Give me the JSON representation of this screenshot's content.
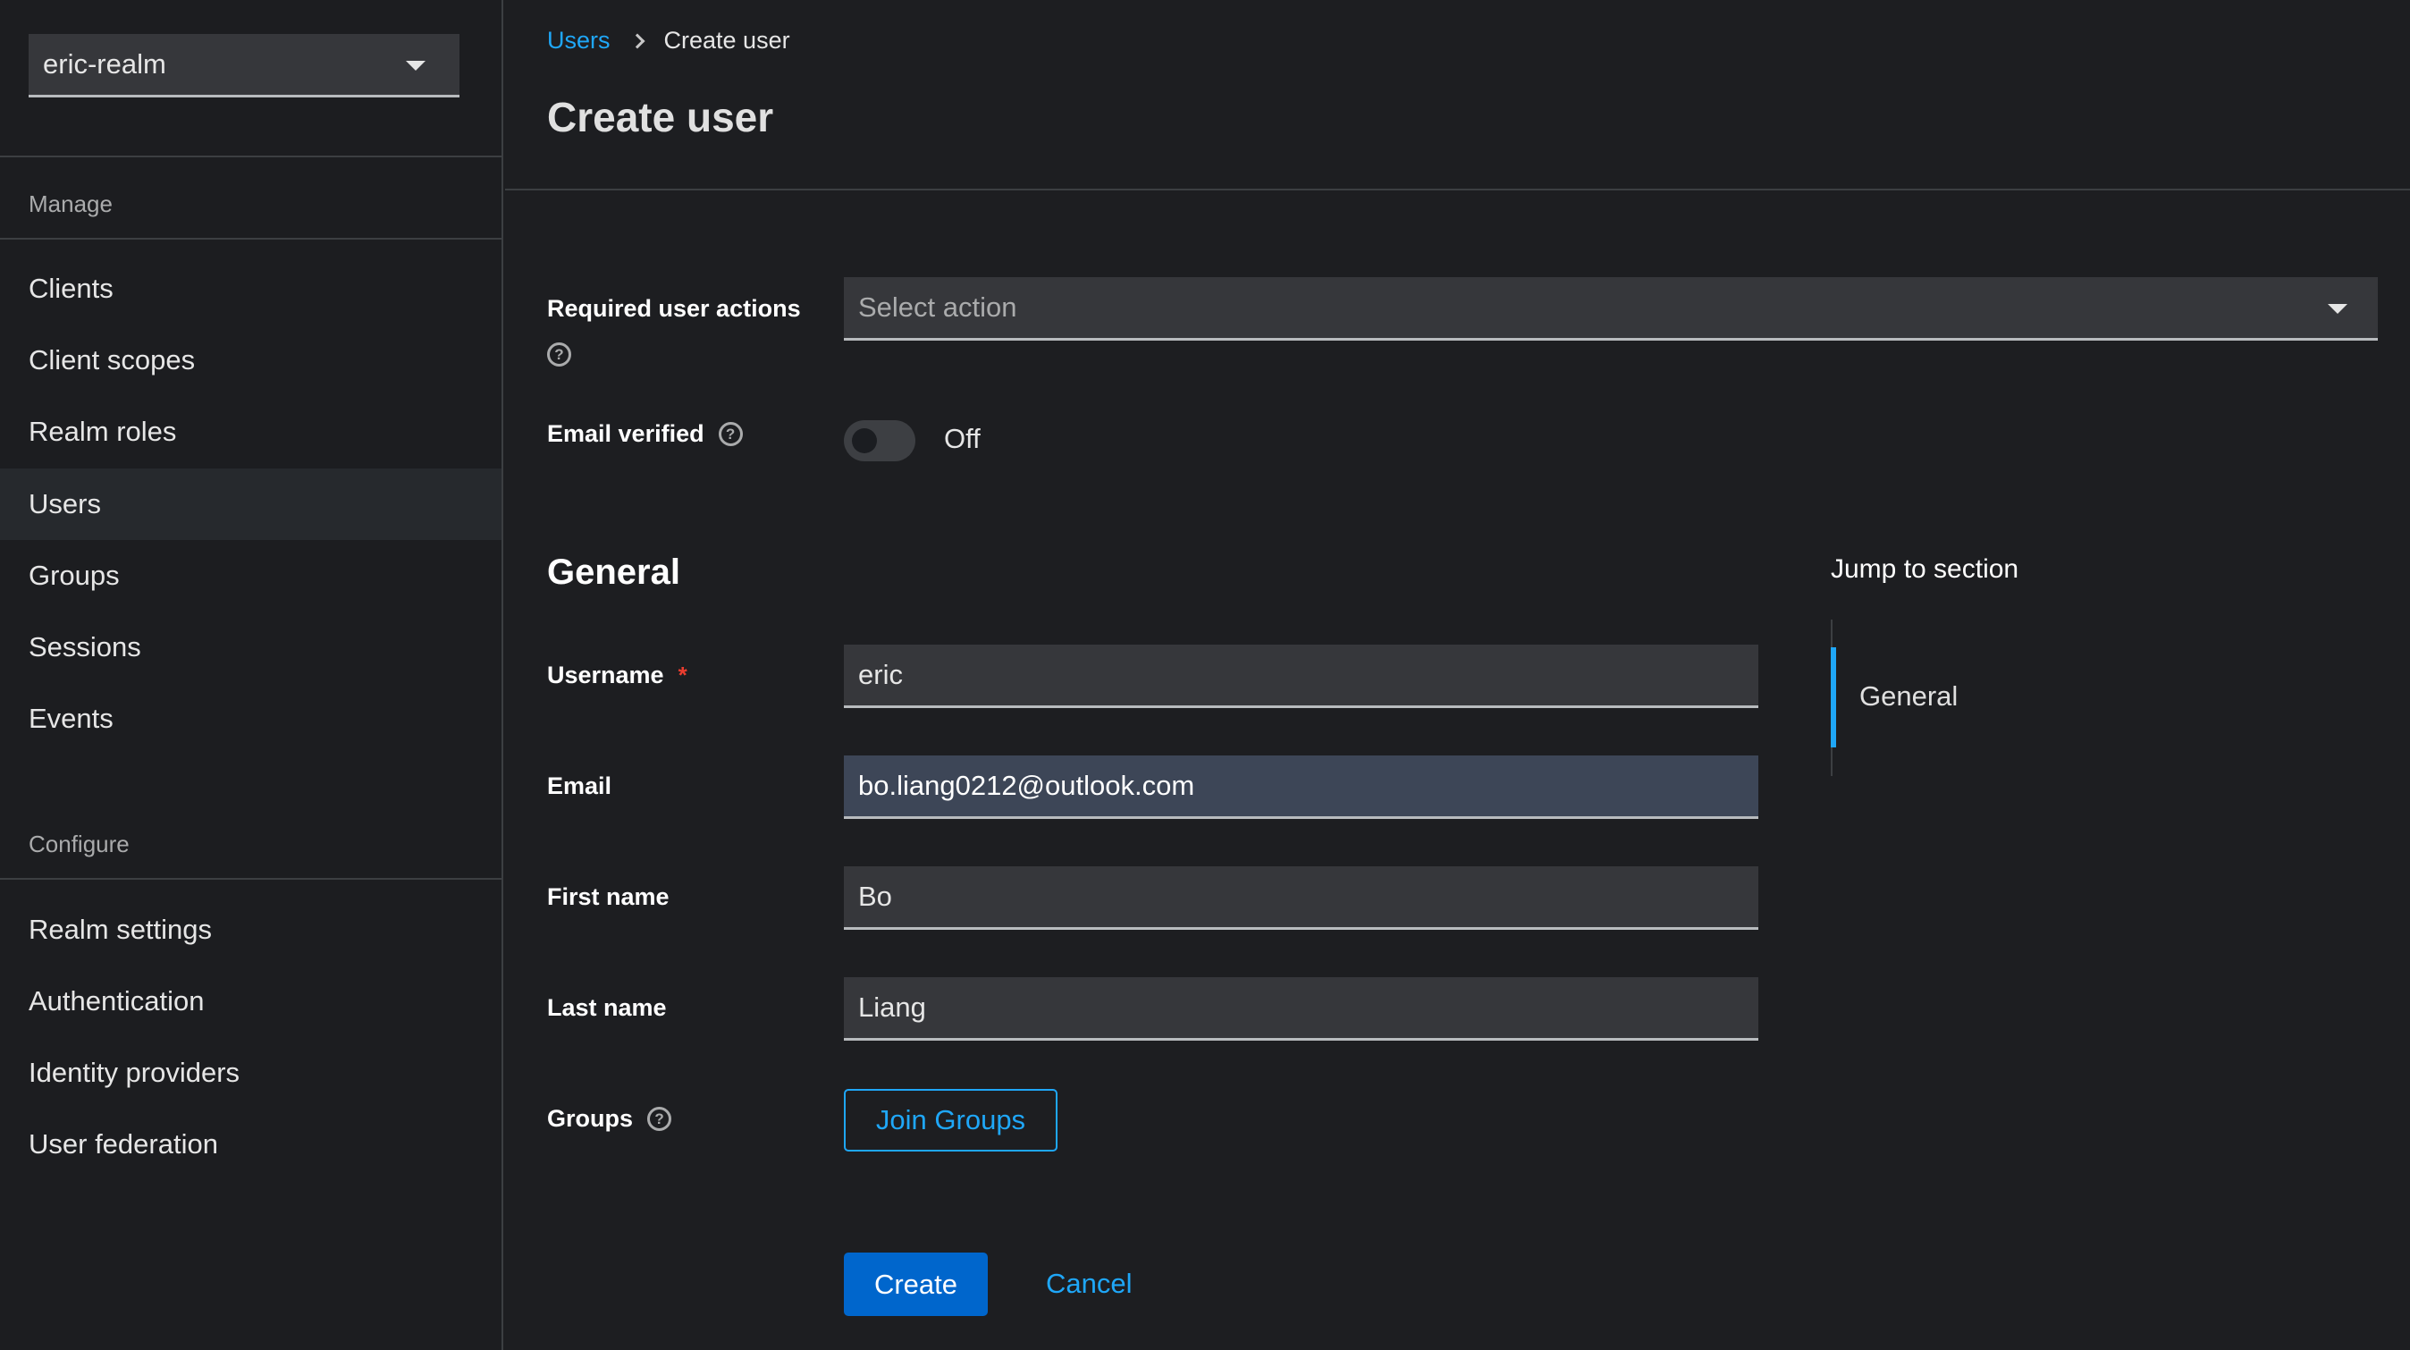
{
  "sidebar": {
    "realm": "eric-realm",
    "sections": [
      {
        "label": "Manage",
        "items": [
          {
            "label": "Clients",
            "active": false
          },
          {
            "label": "Client scopes",
            "active": false
          },
          {
            "label": "Realm roles",
            "active": false
          },
          {
            "label": "Users",
            "active": true
          },
          {
            "label": "Groups",
            "active": false
          },
          {
            "label": "Sessions",
            "active": false
          },
          {
            "label": "Events",
            "active": false
          }
        ]
      },
      {
        "label": "Configure",
        "items": [
          {
            "label": "Realm settings",
            "active": false
          },
          {
            "label": "Authentication",
            "active": false
          },
          {
            "label": "Identity providers",
            "active": false
          },
          {
            "label": "User federation",
            "active": false
          }
        ]
      }
    ]
  },
  "header": {
    "breadcrumb": [
      {
        "label": "Users",
        "link": true
      },
      {
        "label": "Create user",
        "link": false
      }
    ],
    "title": "Create user"
  },
  "form": {
    "required_actions": {
      "label": "Required user actions",
      "placeholder": "Select action"
    },
    "email_verified": {
      "label": "Email verified",
      "value": false,
      "state_label": "Off"
    },
    "general": {
      "title": "General",
      "username": {
        "label": "Username",
        "required": "*",
        "value": "eric"
      },
      "email": {
        "label": "Email",
        "value": "bo.liang0212@outlook.com"
      },
      "first_name": {
        "label": "First name",
        "value": "Bo"
      },
      "last_name": {
        "label": "Last name",
        "value": "Liang"
      },
      "groups": {
        "label": "Groups",
        "button": "Join Groups"
      }
    },
    "actions": {
      "create": "Create",
      "cancel": "Cancel"
    }
  },
  "jump": {
    "title": "Jump to section",
    "items": [
      {
        "label": "General",
        "active": true
      }
    ]
  },
  "icons": {
    "help": "?"
  },
  "colors": {
    "accent": "#1fa7f8",
    "primary_button": "#0066cc",
    "required": "#ec3d2f",
    "background": "#1d1e21"
  }
}
